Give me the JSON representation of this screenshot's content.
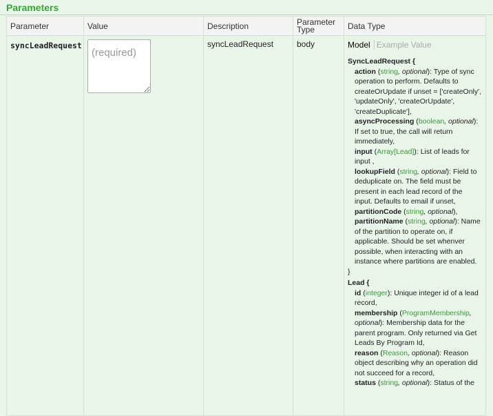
{
  "section_title": "Parameters",
  "columns": [
    "Parameter",
    "Value",
    "Description",
    "Parameter Type",
    "Data Type"
  ],
  "row": {
    "name": "syncLeadRequest",
    "value_placeholder": "(required)",
    "description": "syncLeadRequest",
    "param_type": "body"
  },
  "tabs": {
    "model": "Model",
    "example": "Example Value"
  },
  "models": [
    {
      "name": "SyncLeadRequest {",
      "props": [
        {
          "name": "action",
          "type": "string",
          "opt": ", optional",
          "desc": "): Type of sync operation to perform. Defaults to createOrUpdate if unset = ['createOnly', 'updateOnly', 'createOrUpdate', 'createDuplicate'],"
        },
        {
          "name": "asyncProcessing",
          "type": "boolean",
          "opt": ", optional",
          "desc": "): If set to true, the call will return immediately,"
        },
        {
          "name": "input",
          "type": "Array[Lead]",
          "opt": "",
          "desc": "): List of leads for input ,"
        },
        {
          "name": "lookupField",
          "type": "string",
          "opt": ", optional",
          "desc": "): Field to deduplicate on. The field must be present in each lead record of the input. Defaults to email if unset,"
        },
        {
          "name": "partitionCode",
          "type": "string",
          "opt": ", optional",
          "desc": "),"
        },
        {
          "name": "partitionName",
          "type": "string",
          "opt": ", optional",
          "desc": "): Name of the partition to operate on, if applicable. Should be set whenver possible, when interacting with an instance where partitions are enabled."
        }
      ],
      "close": "}"
    },
    {
      "name": "Lead {",
      "props": [
        {
          "name": "id",
          "type": "integer",
          "opt": "",
          "desc": "): Unique integer id of a lead record,"
        },
        {
          "name": "membership",
          "type": "ProgramMembership",
          "opt": ", optional",
          "desc": "): Membership data for the parent program. Only returned via Get Leads By Program Id,"
        },
        {
          "name": "reason",
          "type": "Reason",
          "opt": ", optional",
          "desc": "): Reason object describing why an operation did not succeed for a record,"
        },
        {
          "name": "status",
          "type": "string",
          "opt": ", optional",
          "desc": "): Status of the"
        }
      ],
      "close": ""
    }
  ],
  "colors": {
    "accent": "#38a738",
    "background": "#eaf5ea",
    "type_link": "#3a9a3a"
  }
}
